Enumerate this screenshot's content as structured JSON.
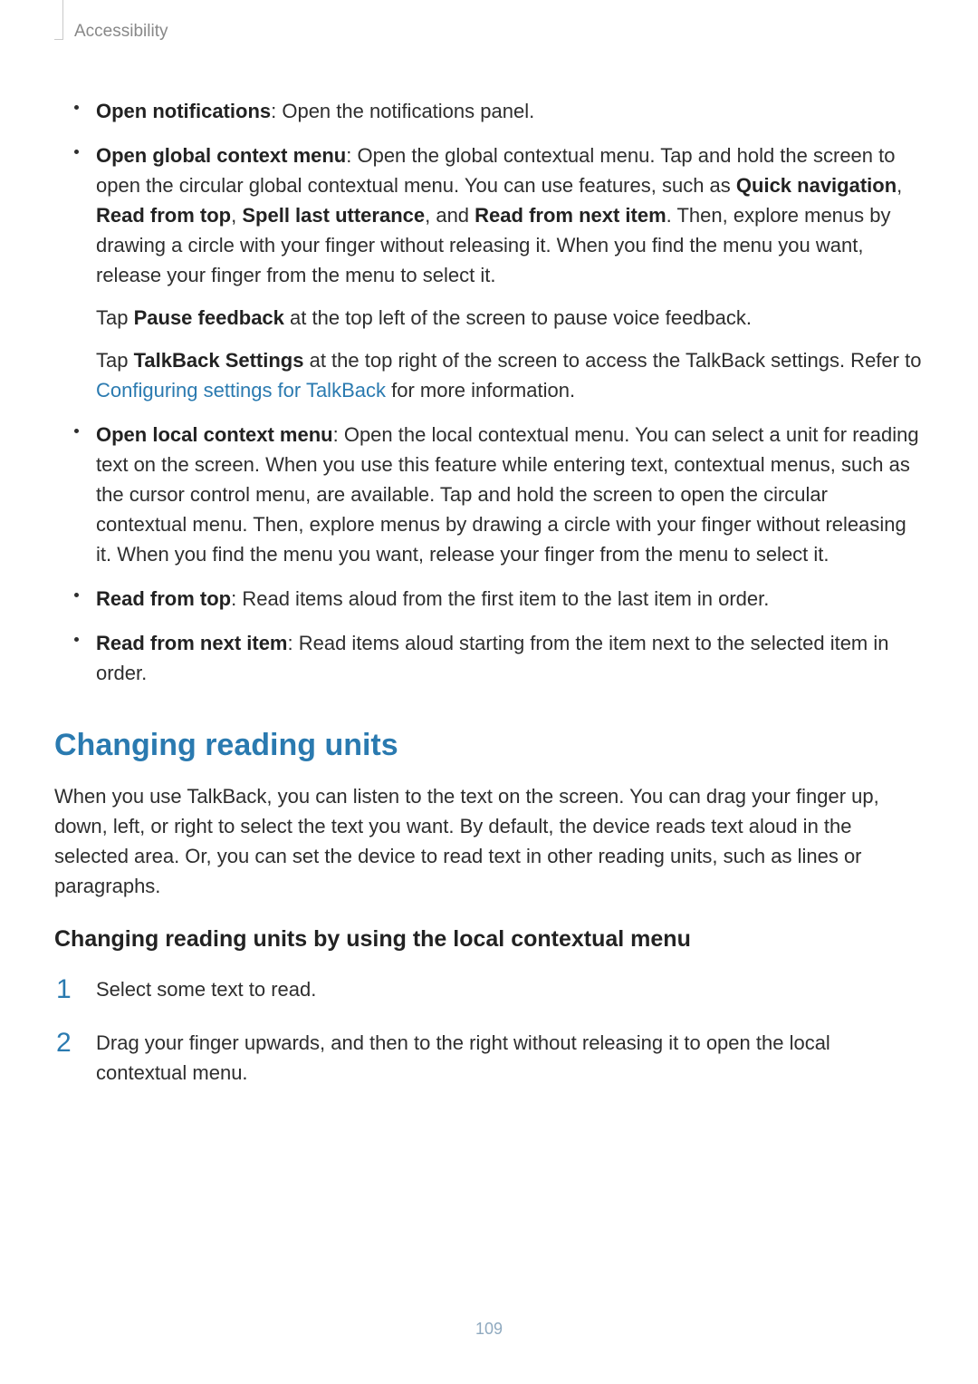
{
  "breadcrumb": "Accessibility",
  "bullets": {
    "item0": {
      "title": "Open notifications",
      "tail": ": Open the notifications panel."
    },
    "item1": {
      "title": "Open global context menu",
      "lead": ": Open the global contextual menu. Tap and hold the screen to open the circular global contextual menu. You can use features, such as ",
      "b1": "Quick navigation",
      "sep1": ", ",
      "b2": "Read from top",
      "sep2": ", ",
      "b3": "Spell last utterance",
      "sep3": ", and ",
      "b4": "Read from next item",
      "tail": ". Then, explore menus by drawing a circle with your finger without releasing it. When you find the menu you want, release your finger from the menu to select it.",
      "p2_lead": "Tap ",
      "p2_b": "Pause feedback",
      "p2_tail": " at the top left of the screen to pause voice feedback.",
      "p3_lead": "Tap ",
      "p3_b": "TalkBack Settings",
      "p3_mid": " at the top right of the screen to access the TalkBack settings. Refer to ",
      "p3_link": "Configuring settings for TalkBack",
      "p3_tail": " for more information."
    },
    "item2": {
      "title": "Open local context menu",
      "tail": ": Open the local contextual menu. You can select a unit for reading text on the screen. When you use this feature while entering text, contextual menus, such as the cursor control menu, are available. Tap and hold the screen to open the circular contextual menu. Then, explore menus by drawing a circle with your finger without releasing it. When you find the menu you want, release your finger from the menu to select it."
    },
    "item3": {
      "title": "Read from top",
      "tail": ": Read items aloud from the first item to the last item in order."
    },
    "item4": {
      "title": "Read from next item",
      "tail": ": Read items aloud starting from the item next to the selected item in order."
    }
  },
  "section_title": "Changing reading units",
  "section_body": "When you use TalkBack, you can listen to the text on the screen. You can drag your finger up, down, left, or right to select the text you want. By default, the device reads text aloud in the selected area. Or, you can set the device to read text in other reading units, such as lines or paragraphs.",
  "subhead": "Changing reading units by using the local contextual menu",
  "steps": {
    "n1": "1",
    "s1": "Select some text to read.",
    "n2": "2",
    "s2": "Drag your finger upwards, and then to the right without releasing it to open the local contextual menu."
  },
  "page_number": "109"
}
